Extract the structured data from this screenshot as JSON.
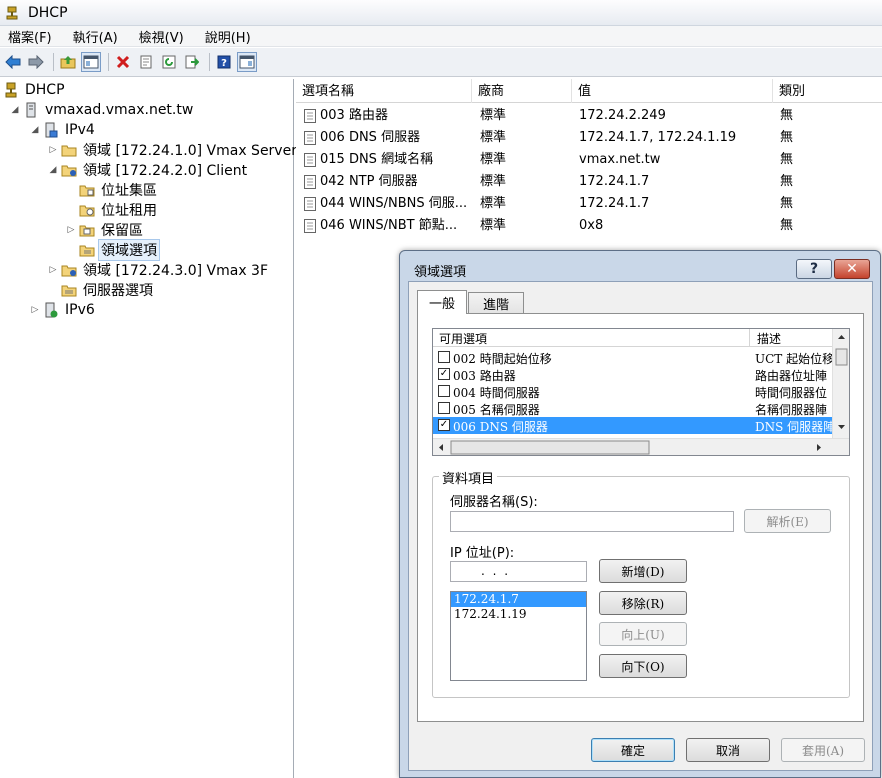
{
  "window": {
    "title": "DHCP"
  },
  "menu": [
    "檔案(F)",
    "執行(A)",
    "檢視(V)",
    "說明(H)"
  ],
  "toolbar": [
    "back-icon",
    "forward-icon",
    "up-folder-icon",
    "show-hide-tree-icon",
    "delete-icon",
    "properties-icon",
    "refresh-icon",
    "export-icon",
    "help-icon",
    "show-action-pane-icon"
  ],
  "tree": [
    {
      "label": "DHCP",
      "icon": "dhcp-icon",
      "expander": "",
      "depth": 0
    },
    {
      "label": "vmaxad.vmax.net.tw",
      "icon": "server-icon",
      "expander": "◢",
      "depth": 1
    },
    {
      "label": "IPv4",
      "icon": "ipv4-icon",
      "expander": "◢",
      "depth": 2
    },
    {
      "label": "領域 [172.24.1.0] Vmax Server",
      "icon": "scope-folder-icon",
      "expander": "▷",
      "depth": 3
    },
    {
      "label": "領域 [172.24.2.0] Client",
      "icon": "scope-folder-icon",
      "expander": "◢",
      "depth": 3
    },
    {
      "label": "位址集區",
      "icon": "address-pool-icon",
      "expander": "",
      "depth": 4
    },
    {
      "label": "位址租用",
      "icon": "address-lease-icon",
      "expander": "",
      "depth": 4
    },
    {
      "label": "保留區",
      "icon": "reservation-icon",
      "expander": "▷",
      "depth": 4
    },
    {
      "label": "領域選項",
      "icon": "scope-options-icon",
      "expander": "",
      "depth": 4,
      "selected": true
    },
    {
      "label": "領域 [172.24.3.0] Vmax 3F",
      "icon": "scope-folder-icon",
      "expander": "▷",
      "depth": 3
    },
    {
      "label": "伺服器選項",
      "icon": "server-options-icon",
      "expander": "",
      "depth": 3
    },
    {
      "label": "IPv6",
      "icon": "ipv6-icon",
      "expander": "▷",
      "depth": 2
    }
  ],
  "list": {
    "columns": [
      "選項名稱",
      "廠商",
      "值",
      "類別"
    ],
    "rows": [
      [
        "003 路由器",
        "標準",
        "172.24.2.249",
        "無"
      ],
      [
        "006 DNS 伺服器",
        "標準",
        "172.24.1.7, 172.24.1.19",
        "無"
      ],
      [
        "015 DNS 網域名稱",
        "標準",
        "vmax.net.tw",
        "無"
      ],
      [
        "042 NTP 伺服器",
        "標準",
        "172.24.1.7",
        "無"
      ],
      [
        "044 WINS/NBNS 伺服...",
        "標準",
        "172.24.1.7",
        "無"
      ],
      [
        "046 WINS/NBT 節點...",
        "標準",
        "0x8",
        "無"
      ]
    ]
  },
  "dialog": {
    "title": "領域選項",
    "help": "?",
    "close": "✕",
    "tabs": [
      "一般",
      "進階"
    ],
    "options_header": [
      "可用選項",
      "描述"
    ],
    "options": [
      {
        "name": "002 時間起始位移",
        "desc": "UCT 起始位移",
        "checked": false
      },
      {
        "name": "003 路由器",
        "desc": "路由器位址陣",
        "checked": true
      },
      {
        "name": "004 時間伺服器",
        "desc": "時間伺服器位",
        "checked": false
      },
      {
        "name": "005 名稱伺服器",
        "desc": "名稱伺服器陣",
        "checked": false
      },
      {
        "name": "006 DNS 伺服器",
        "desc": "DNS 伺服器陣",
        "checked": true,
        "selected": true
      }
    ],
    "group_title": "資料項目",
    "server_name_label": "伺服器名稱(S):",
    "server_name_value": "",
    "resolve": "解析(E)",
    "ip_label": "IP 位址(P):",
    "ip_value": ".    .    .",
    "ip_list": [
      "172.24.1.7",
      "172.24.1.19"
    ],
    "add": "新增(D)",
    "remove": "移除(R)",
    "up": "向上(U)",
    "down": "向下(O)",
    "ok": "確定",
    "cancel": "取消",
    "apply": "套用(A)"
  }
}
